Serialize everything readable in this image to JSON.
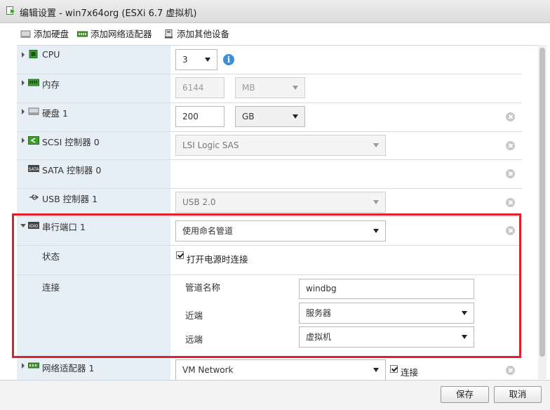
{
  "window": {
    "title": "编辑设置 - win7x64org (ESXi 6.7 虚拟机)"
  },
  "toolbar": {
    "add_disk": "添加硬盘",
    "add_network_adapter": "添加网络适配器",
    "add_other_device": "添加其他设备"
  },
  "devices": {
    "cpu": {
      "label": "CPU",
      "value": "3"
    },
    "memory": {
      "label": "内存",
      "value": "6144",
      "unit": "MB"
    },
    "disk": {
      "label": "硬盘 1",
      "value": "200",
      "unit": "GB"
    },
    "scsi": {
      "label": "SCSI 控制器 0",
      "value": "LSI Logic SAS"
    },
    "sata": {
      "label": "SATA 控制器 0"
    },
    "usb": {
      "label": "USB 控制器 1",
      "value": "USB 2.0"
    },
    "serial": {
      "label": "串行端口 1",
      "value": "使用命名管道",
      "status_label": "状态",
      "status_checkbox_label": "打开电源时连接",
      "status_checked": true,
      "connection_label": "连接",
      "pipe_name_label": "管道名称",
      "pipe_name_value": "windbg",
      "near_end_label": "近端",
      "near_end_value": "服务器",
      "far_end_label": "远端",
      "far_end_value": "虚拟机"
    },
    "network": {
      "label": "网络适配器 1",
      "value": "VM Network",
      "connect_label": "连接",
      "connect_checked": true
    }
  },
  "footer": {
    "save": "保存",
    "cancel": "取消"
  },
  "colors": {
    "highlight": "#e0202a",
    "info": "#3a8fd8",
    "left_column": "#e6eef6"
  }
}
